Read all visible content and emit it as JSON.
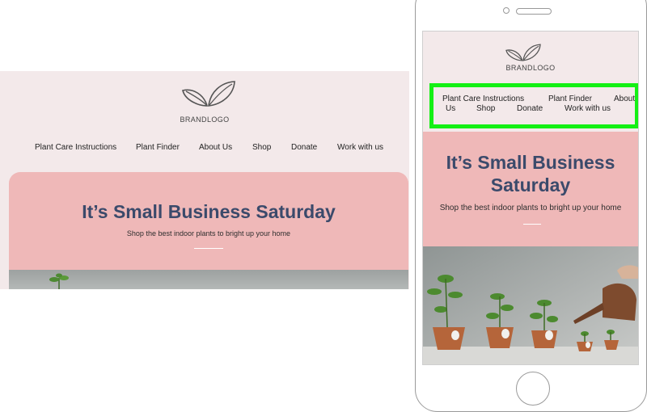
{
  "brand": {
    "logo_text": "BRANDLOGO"
  },
  "nav": {
    "items": [
      "Plant Care Instructions",
      "Plant Finder",
      "About Us",
      "Shop",
      "Donate",
      "Work with us"
    ],
    "mobile_rows": {
      "row1": [
        "Plant Care Instructions",
        "Plant Finder",
        "About"
      ],
      "row2": [
        "Us",
        "Shop",
        "Donate",
        "Work with us"
      ]
    }
  },
  "hero": {
    "title": "It’s Small Business Saturday",
    "mobile_title_line1": "It’s Small Business",
    "mobile_title_line2": "Saturday",
    "subtitle": "Shop the best indoor plants to bright up your home"
  },
  "colors": {
    "page_bg": "#f3e9ea",
    "hero_bg": "#efb8b8",
    "title_color": "#3b4a6b",
    "highlight": "#14f014"
  },
  "icons": {
    "logo": "leaf-icon",
    "mobile_logo": "leaf-icon"
  }
}
